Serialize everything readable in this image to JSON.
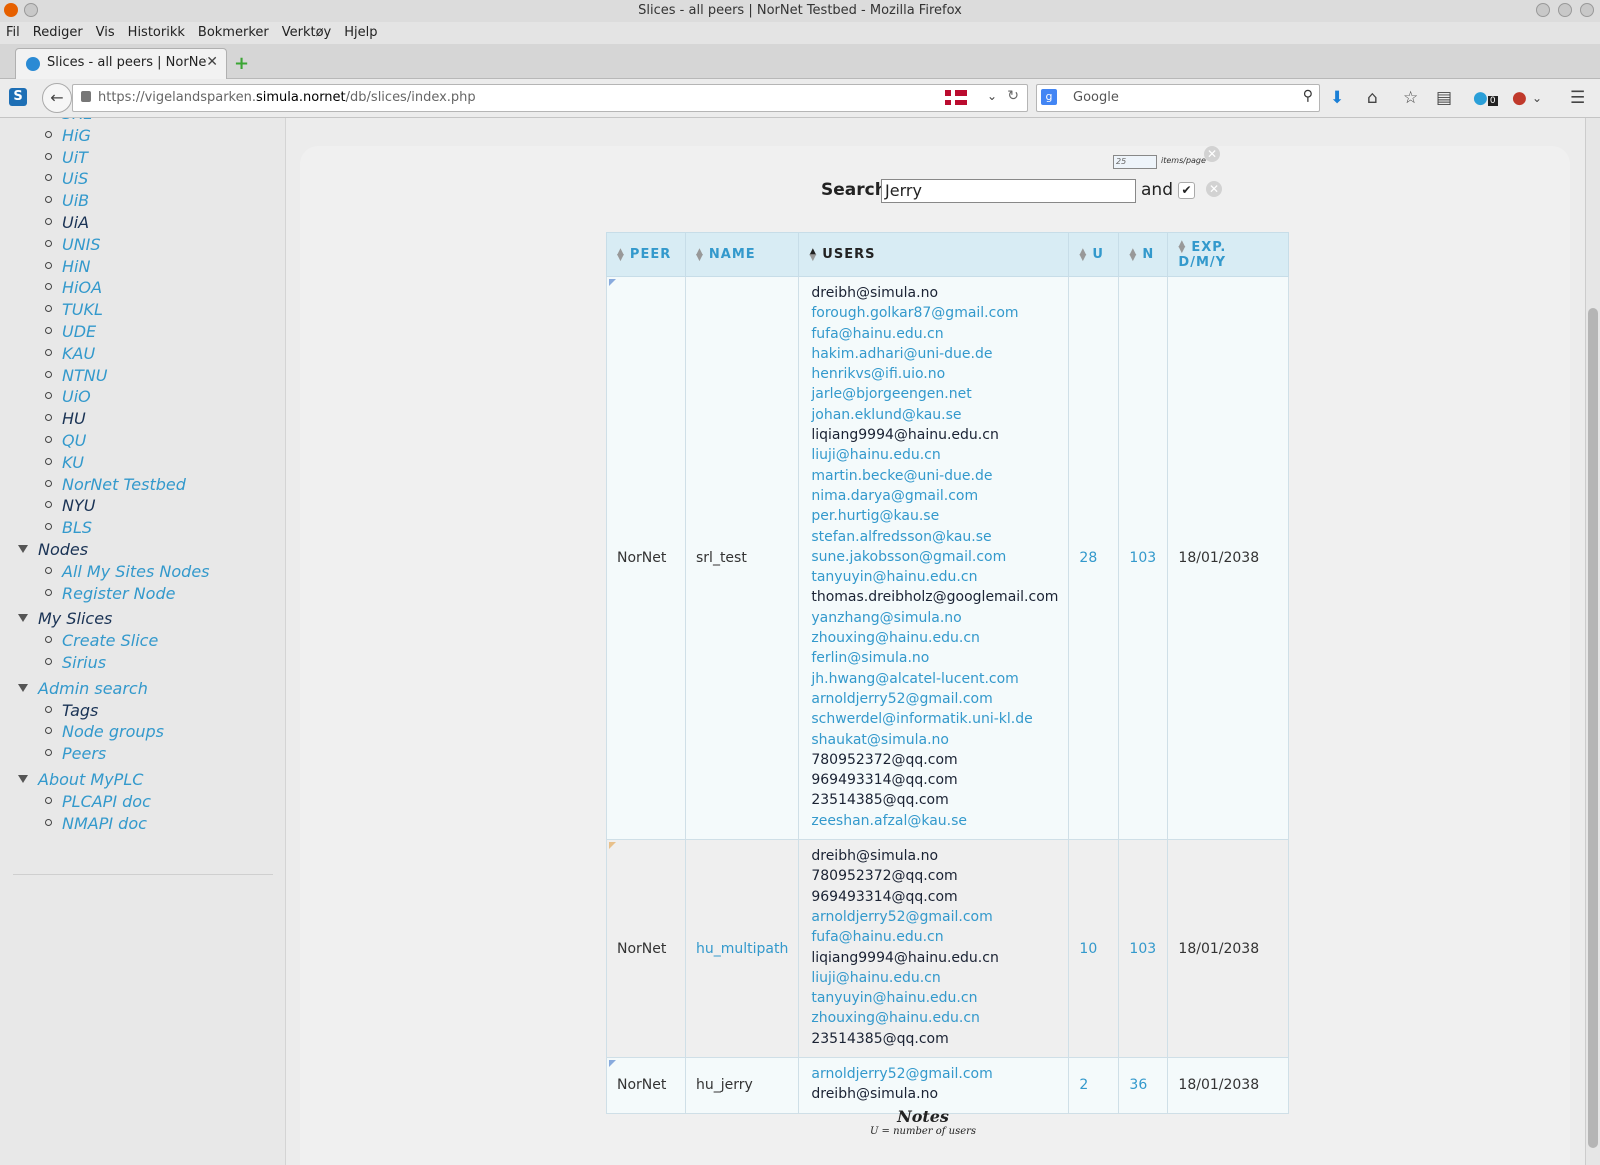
{
  "window": {
    "title": "Slices - all peers | NorNet Testbed - Mozilla Firefox"
  },
  "menu": [
    "Fil",
    "Rediger",
    "Vis",
    "Historikk",
    "Bokmerker",
    "Verktøy",
    "Hjelp"
  ],
  "tab": {
    "title": "Slices - all peers | NorNet ..."
  },
  "nav": {
    "url_prefix": "https://vigelandsparken.",
    "url_domain": "simula.nornet",
    "url_suffix": "/db/slices/index.php",
    "search_placeholder": "Google",
    "notif_count": "0"
  },
  "sidebar": {
    "sites": [
      {
        "label": "SRL",
        "dark": false
      },
      {
        "label": "HiG",
        "dark": false
      },
      {
        "label": "UiT",
        "dark": false
      },
      {
        "label": "UiS",
        "dark": false
      },
      {
        "label": "UiB",
        "dark": false
      },
      {
        "label": "UiA",
        "dark": true
      },
      {
        "label": "UNIS",
        "dark": false
      },
      {
        "label": "HiN",
        "dark": false
      },
      {
        "label": "HiOA",
        "dark": false
      },
      {
        "label": "TUKL",
        "dark": false
      },
      {
        "label": "UDE",
        "dark": false
      },
      {
        "label": "KAU",
        "dark": false
      },
      {
        "label": "NTNU",
        "dark": false
      },
      {
        "label": "UiO",
        "dark": false
      },
      {
        "label": "HU",
        "dark": true
      },
      {
        "label": "QU",
        "dark": false
      },
      {
        "label": "KU",
        "dark": false
      },
      {
        "label": "NorNet Testbed",
        "dark": false
      },
      {
        "label": "NYU",
        "dark": true
      },
      {
        "label": "BLS",
        "dark": false
      }
    ],
    "sections": [
      {
        "label": "Nodes",
        "dark": true,
        "items": [
          {
            "label": "All My Sites Nodes",
            "dark": false
          },
          {
            "label": "Register Node",
            "dark": false
          }
        ]
      },
      {
        "label": "My Slices",
        "dark": true,
        "items": [
          {
            "label": "Create Slice",
            "dark": false
          },
          {
            "label": "Sirius",
            "dark": false
          }
        ]
      },
      {
        "label": "Admin search",
        "dark": false,
        "items": [
          {
            "label": "Tags",
            "dark": true
          },
          {
            "label": "Node groups",
            "dark": false
          },
          {
            "label": "Peers",
            "dark": false
          }
        ]
      },
      {
        "label": "About MyPLC",
        "dark": false,
        "items": [
          {
            "label": "PLCAPI doc",
            "dark": false
          },
          {
            "label": "NMAPI doc",
            "dark": false
          }
        ]
      }
    ]
  },
  "filter": {
    "items_per_page": "25",
    "items_per_page_label": "items/page",
    "search_label": "Search",
    "search_value": "Jerry",
    "and_label": "and"
  },
  "table": {
    "headers": [
      "PEER",
      "NAME",
      "USERS",
      "U",
      "N",
      "EXP. D/M/Y"
    ],
    "rows": [
      {
        "peer": "NorNet",
        "name": "srl_test",
        "name_link": false,
        "u": "28",
        "n": "103",
        "exp": "18/01/2038",
        "marker": "blue",
        "users": [
          {
            "email": "dreibh@simula.no",
            "link": false
          },
          {
            "email": "forough.golkar87@gmail.com",
            "link": true
          },
          {
            "email": "fufa@hainu.edu.cn",
            "link": true
          },
          {
            "email": "hakim.adhari@uni-due.de",
            "link": true
          },
          {
            "email": "henrikvs@ifi.uio.no",
            "link": true
          },
          {
            "email": "jarle@bjorgeengen.net",
            "link": true
          },
          {
            "email": "johan.eklund@kau.se",
            "link": true
          },
          {
            "email": "liqiang9994@hainu.edu.cn",
            "link": false
          },
          {
            "email": "liuji@hainu.edu.cn",
            "link": true
          },
          {
            "email": "martin.becke@uni-due.de",
            "link": true
          },
          {
            "email": "nima.darya@gmail.com",
            "link": true
          },
          {
            "email": "per.hurtig@kau.se",
            "link": true
          },
          {
            "email": "stefan.alfredsson@kau.se",
            "link": true
          },
          {
            "email": "sune.jakobsson@gmail.com",
            "link": true
          },
          {
            "email": "tanyuyin@hainu.edu.cn",
            "link": true
          },
          {
            "email": "thomas.dreibholz@googlemail.com",
            "link": false
          },
          {
            "email": "yanzhang@simula.no",
            "link": true
          },
          {
            "email": "zhouxing@hainu.edu.cn",
            "link": true
          },
          {
            "email": "ferlin@simula.no",
            "link": true
          },
          {
            "email": "jh.hwang@alcatel-lucent.com",
            "link": true
          },
          {
            "email": "arnoldjerry52@gmail.com",
            "link": true
          },
          {
            "email": "schwerdel@informatik.uni-kl.de",
            "link": true
          },
          {
            "email": "shaukat@simula.no",
            "link": true
          },
          {
            "email": "780952372@qq.com",
            "link": false
          },
          {
            "email": "969493314@qq.com",
            "link": false
          },
          {
            "email": "23514385@qq.com",
            "link": false
          },
          {
            "email": "zeeshan.afzal@kau.se",
            "link": true
          }
        ]
      },
      {
        "peer": "NorNet",
        "name": "hu_multipath",
        "name_link": true,
        "u": "10",
        "n": "103",
        "exp": "18/01/2038",
        "marker": "orange",
        "users": [
          {
            "email": "dreibh@simula.no",
            "link": false
          },
          {
            "email": "780952372@qq.com",
            "link": false
          },
          {
            "email": "969493314@qq.com",
            "link": false
          },
          {
            "email": "arnoldjerry52@gmail.com",
            "link": true
          },
          {
            "email": "fufa@hainu.edu.cn",
            "link": true
          },
          {
            "email": "liqiang9994@hainu.edu.cn",
            "link": false
          },
          {
            "email": "liuji@hainu.edu.cn",
            "link": true
          },
          {
            "email": "tanyuyin@hainu.edu.cn",
            "link": true
          },
          {
            "email": "zhouxing@hainu.edu.cn",
            "link": true
          },
          {
            "email": "23514385@qq.com",
            "link": false
          }
        ]
      },
      {
        "peer": "NorNet",
        "name": "hu_jerry",
        "name_link": false,
        "u": "2",
        "n": "36",
        "exp": "18/01/2038",
        "marker": "blue",
        "users": [
          {
            "email": "arnoldjerry52@gmail.com",
            "link": true
          },
          {
            "email": "dreibh@simula.no",
            "link": false
          }
        ]
      }
    ]
  },
  "notes": {
    "title": "Notes",
    "line1": "U = number of users"
  }
}
